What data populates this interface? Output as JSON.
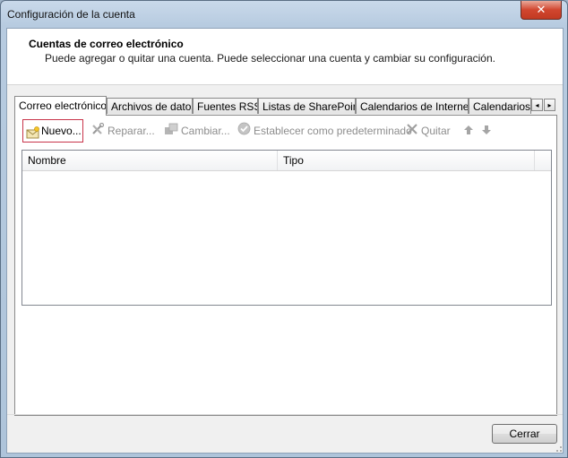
{
  "window": {
    "title": "Configuración de la cuenta",
    "close_glyph": "✕"
  },
  "header": {
    "title": "Cuentas de correo electrónico",
    "subtitle": "Puede agregar o quitar una cuenta. Puede seleccionar una cuenta y cambiar su configuración."
  },
  "tabs": [
    {
      "label": "Correo electrónico",
      "active": true
    },
    {
      "label": "Archivos de datos"
    },
    {
      "label": "Fuentes RSS"
    },
    {
      "label": "Listas de SharePoint"
    },
    {
      "label": "Calendarios de Internet"
    },
    {
      "label": "Calendarios p"
    }
  ],
  "tab_scroll": {
    "left": "◂",
    "right": "▸"
  },
  "toolbar": {
    "new_label": "Nuevo...",
    "repair_label": "Reparar...",
    "change_label": "Cambiar...",
    "default_label": "Establecer como predeterminado",
    "remove_label": "Quitar"
  },
  "list": {
    "columns": [
      "Nombre",
      "Tipo"
    ],
    "rows": []
  },
  "footer": {
    "close_label": "Cerrar"
  },
  "colors": {
    "frame": "#b7cbe0",
    "close_red": "#c23a22",
    "highlight_border": "#c8344a"
  }
}
